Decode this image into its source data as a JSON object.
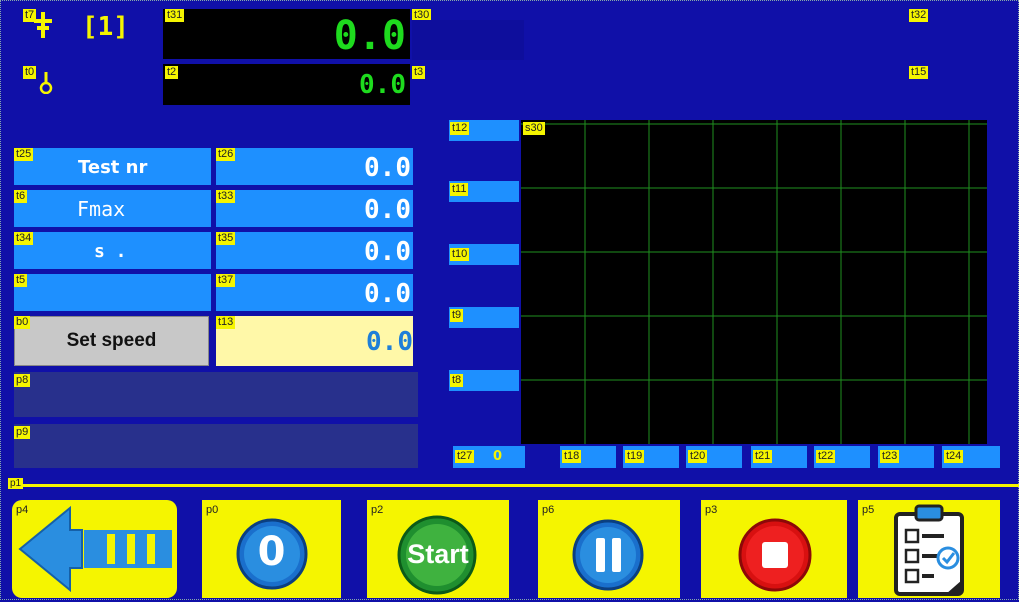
{
  "tags": {
    "t7": "t7",
    "t0": "t0",
    "t31": "t31",
    "t2": "t2",
    "t30": "t30",
    "t3": "t3",
    "t32": "t32",
    "t15": "t15",
    "t25": "t25",
    "t26": "t26",
    "t6": "t6",
    "t33": "t33",
    "t34": "t34",
    "t35": "t35",
    "t5": "t5",
    "t37": "t37",
    "b0": "b0",
    "t13": "t13",
    "p8": "p8",
    "p9": "p9",
    "t12": "t12",
    "s30": "s30",
    "t11": "t11",
    "t10": "t10",
    "t9": "t9",
    "t8": "t8",
    "t27": "t27",
    "t18": "t18",
    "t19": "t19",
    "t20": "t20",
    "t21": "t21",
    "t22": "t22",
    "t23": "t23",
    "t24": "t24",
    "p1": "p1",
    "p4": "p4",
    "p0": "p0",
    "p2": "p2",
    "p6": "p6",
    "p3": "p3",
    "p5": "p5"
  },
  "header": {
    "channel": "[1]",
    "main_value": "0.0",
    "secondary_value": "0.0"
  },
  "rows": [
    {
      "label": "Test nr",
      "value": "0.0"
    },
    {
      "label": "Fmax",
      "value": "0.0"
    },
    {
      "label": "s .",
      "value": "0.0"
    },
    {
      "label": "",
      "value": "0.0"
    }
  ],
  "speed": {
    "button_label": "Set speed",
    "value": "0.0"
  },
  "chart": {
    "x_start": "0"
  },
  "toolbar": {
    "start_label": "Start",
    "zero_label": "0"
  },
  "colors": {
    "background": "#1010a8",
    "accent_yellow": "#f5f500",
    "value_green": "#1edb1e",
    "field_blue": "#1e90ff",
    "grid_green": "#1f8f1f"
  }
}
